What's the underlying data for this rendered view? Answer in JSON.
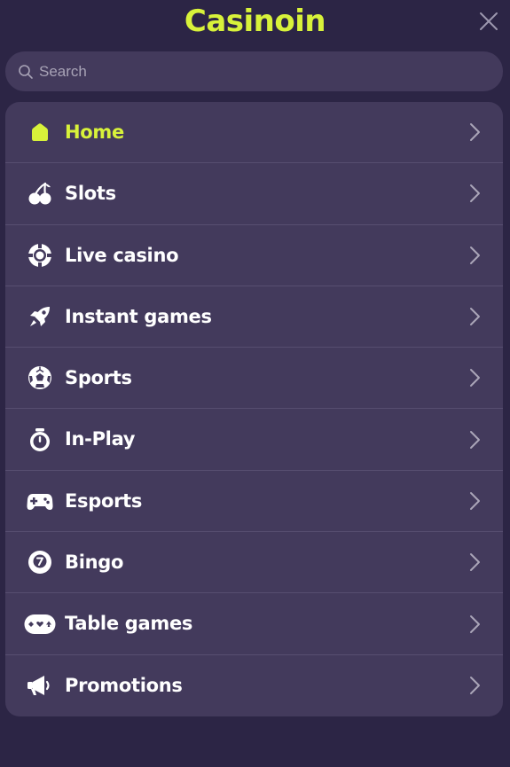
{
  "header": {
    "logo_text": "Casinoin",
    "close_icon": "close-icon"
  },
  "search": {
    "placeholder": "Search",
    "value": "",
    "icon": "search-icon"
  },
  "menu": {
    "items": [
      {
        "label": "Home",
        "icon": "home-icon",
        "active": true
      },
      {
        "label": "Slots",
        "icon": "cherry-icon",
        "active": false
      },
      {
        "label": "Live casino",
        "icon": "poker-chip-icon",
        "active": false
      },
      {
        "label": "Instant games",
        "icon": "rocket-icon",
        "active": false
      },
      {
        "label": "Sports",
        "icon": "soccer-ball-icon",
        "active": false
      },
      {
        "label": "In-Play",
        "icon": "stopwatch-icon",
        "active": false
      },
      {
        "label": "Esports",
        "icon": "gamepad-icon",
        "active": false
      },
      {
        "label": "Bingo",
        "icon": "bingo-ball-icon",
        "active": false
      },
      {
        "label": "Table games",
        "icon": "card-suits-icon",
        "active": false
      },
      {
        "label": "Promotions",
        "icon": "megaphone-icon",
        "active": false
      }
    ]
  },
  "colors": {
    "background": "#2c2545",
    "panel": "#433a5c",
    "divider": "#574e70",
    "accent": "#d8f23a",
    "text": "#ffffff",
    "muted": "#a8a3b6"
  }
}
